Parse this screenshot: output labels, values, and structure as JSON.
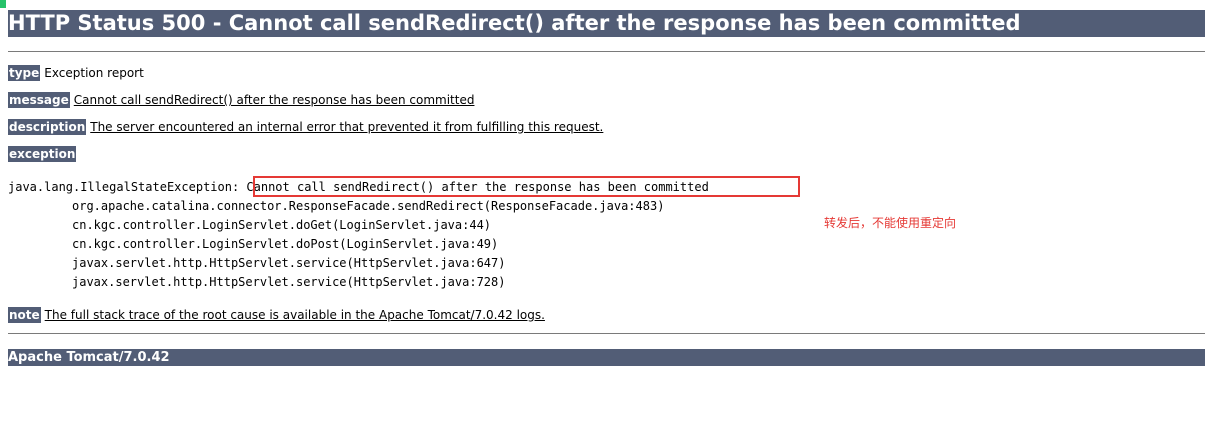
{
  "colors": {
    "header_bg": "#525d76",
    "header_text": "#ffffff",
    "annotation": "#e53935",
    "highlight_border": "#e53935",
    "corner_mark": "#27c26a"
  },
  "title": "HTTP Status 500 - Cannot call sendRedirect() after the response has been committed",
  "type": {
    "label": "type",
    "value": "Exception report"
  },
  "message": {
    "label": "message",
    "value": "Cannot call sendRedirect() after the response has been committed"
  },
  "description": {
    "label": "description",
    "value": "The server encountered an internal error that prevented it from fulfilling this request."
  },
  "exception": {
    "label": "exception",
    "trace": [
      "java.lang.IllegalStateException: Cannot call sendRedirect() after the response has been committed",
      "org.apache.catalina.connector.ResponseFacade.sendRedirect(ResponseFacade.java:483)",
      "cn.kgc.controller.LoginServlet.doGet(LoginServlet.java:44)",
      "cn.kgc.controller.LoginServlet.doPost(LoginServlet.java:49)",
      "javax.servlet.http.HttpServlet.service(HttpServlet.java:647)",
      "javax.servlet.http.HttpServlet.service(HttpServlet.java:728)"
    ]
  },
  "note": {
    "label": "note",
    "value": "The full stack trace of the root cause is available in the Apache Tomcat/7.0.42 logs."
  },
  "annotation_text": "转发后，不能使用重定向",
  "footer": "Apache Tomcat/7.0.42"
}
